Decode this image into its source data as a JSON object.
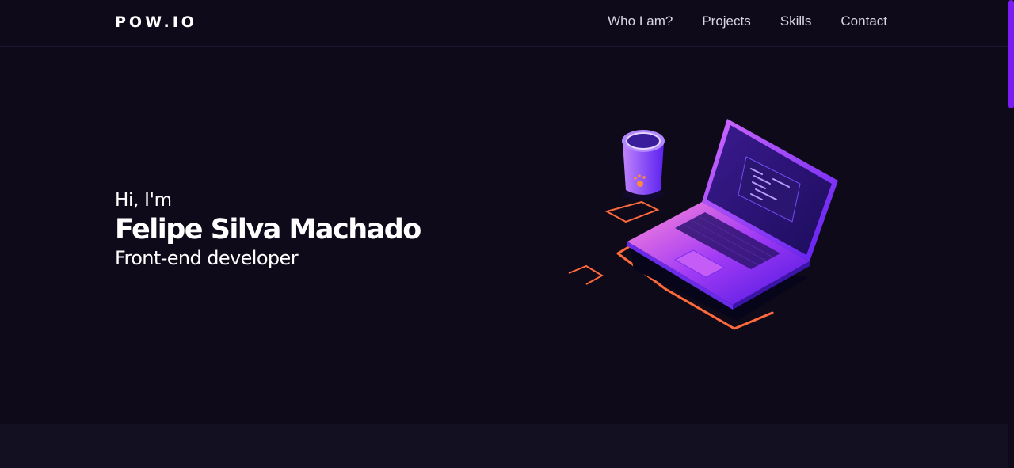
{
  "header": {
    "logo": "POW.IO",
    "nav": [
      {
        "label": "Who I am?"
      },
      {
        "label": "Projects"
      },
      {
        "label": "Skills"
      },
      {
        "label": "Contact"
      }
    ]
  },
  "hero": {
    "greeting": "Hi, I'm",
    "name": "Felipe Silva Machado",
    "role": "Front-end developer",
    "illustration_icon": "laptop-coffee-illustration"
  },
  "colors": {
    "background": "#0e0a1a",
    "accent_purple": "#7a1cf2",
    "accent_orange": "#ff6a3d",
    "nav_text": "#d9d6e3"
  }
}
